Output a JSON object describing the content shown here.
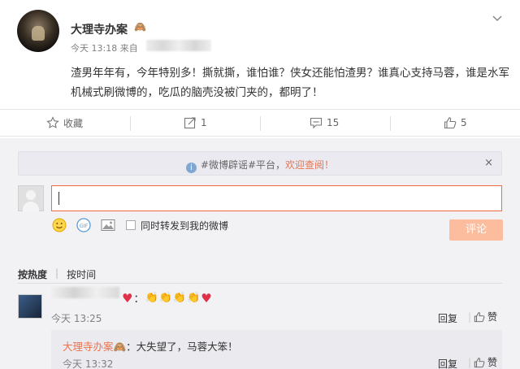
{
  "post": {
    "author": "大理寺办案",
    "badge": "🙈",
    "time": "今天 13:18 来自",
    "text": "渣男年年有，今年特别多！撕就撕，谁怕谁？侠女还能怕渣男？谁真心支持马蓉，谁是水军机械式刷微博的，吃瓜的脑壳没被门夹的，都明了！",
    "menu_icon": "chevron-down-icon"
  },
  "actions": {
    "collect": "收藏",
    "forward": "1",
    "comment": "15",
    "like": "5"
  },
  "notice": {
    "prefix": "#微博辟谣#平台，",
    "highlight": "欢迎查阅！",
    "close": "×"
  },
  "composer": {
    "checkbox_label": "同时转发到我的微博",
    "submit": "评论"
  },
  "sort": {
    "hot": "按热度",
    "time": "按时间"
  },
  "comments": [
    {
      "time": "今天 13:25",
      "reply": "回复",
      "like": "赞",
      "sub": {
        "name": "大理寺办案",
        "badge": "🙈",
        "text": "：大失望了，马蓉大笨！",
        "time": "今天 13:32",
        "reply": "回复",
        "like": "赞"
      }
    }
  ],
  "colors": {
    "accent": "#eb7350",
    "submit_bg": "#fbbd9d",
    "panel_bg": "#f2f2f5"
  }
}
